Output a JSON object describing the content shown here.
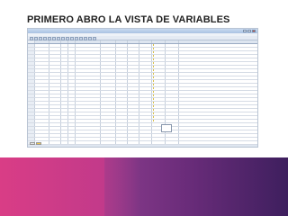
{
  "slide": {
    "title": "PRIMERO ABRO LA VISTA DE VARIABLES"
  },
  "colors": {
    "accent_pink": "#d93d86",
    "accent_purple": "#6a2c7a",
    "measure_icon": "#d9c04a"
  }
}
